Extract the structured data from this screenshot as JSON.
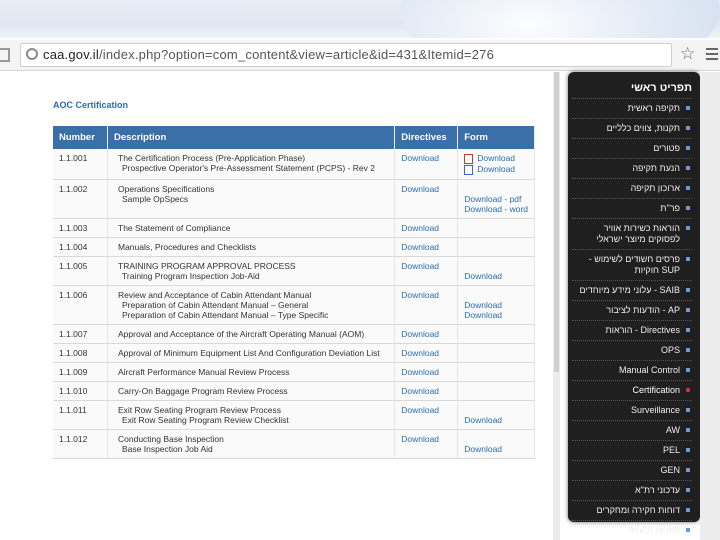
{
  "browser": {
    "url_domain": "caa.gov.il",
    "url_path": "/index.php?option=com_content&view=article&id=431&Itemid=276"
  },
  "page": {
    "title": "AOC Certification",
    "columns": [
      "Number",
      "Description",
      "Directives",
      "Form"
    ],
    "rows": [
      {
        "number": "1.1.001",
        "desc": "The Certification Process (Pre-Application Phase)",
        "sub": "Prospective Operator's Pre-Assessment Statement (PCPS) - Rev 2",
        "directive": "Download",
        "forms": [
          "Download",
          "Download"
        ],
        "form_icons": [
          "pdf-icon",
          "word-icon"
        ]
      },
      {
        "number": "1.1.002",
        "desc": "Operations Specifications",
        "sub": "Sample OpSpecs",
        "directive": "Download",
        "forms": [
          "Download - pdf",
          "Download - word"
        ]
      },
      {
        "number": "1.1.003",
        "desc": "The Statement of Compliance",
        "directive": "Download"
      },
      {
        "number": "1.1.004",
        "desc": "Manuals, Procedures and Checklists",
        "directive": "Download"
      },
      {
        "number": "1.1.005",
        "desc": "TRAINING PROGRAM APPROVAL PROCESS",
        "sub": "Training Program Inspection Job-Aid",
        "directive": "Download",
        "forms": [
          "Download"
        ]
      },
      {
        "number": "1.1.006",
        "desc": "Review and Acceptance of Cabin Attendant Manual",
        "sub": "Preparation of Cabin Attendant Manual – General",
        "sub2": "Preparation of Cabin Attendant Manual – Type Specific",
        "directive": "Download",
        "forms": [
          "Download",
          "Download"
        ]
      },
      {
        "number": "1.1.007",
        "desc": "Approval and Acceptance of the Aircraft Operating Manual (AOM)",
        "directive": "Download"
      },
      {
        "number": "1.1.008",
        "desc": "Approval of Minimum Equipment List And Configuration Deviation List",
        "directive": "Download"
      },
      {
        "number": "1.1.009",
        "desc": "Aircraft Performance Manual Review Process",
        "directive": "Download"
      },
      {
        "number": "1.1.010",
        "desc": "Carry-On Baggage Program Review Process",
        "directive": "Download"
      },
      {
        "number": "1.1.011",
        "desc": "Exit Row Seating Program Review Process",
        "sub": "Exit Row Seating Program Review Checklist",
        "directive": "Download",
        "forms": [
          "Download"
        ]
      },
      {
        "number": "1.1.012",
        "desc": "Conducting Base Inspection",
        "sub": "Base Inspection Job Aid",
        "directive": "Download",
        "forms": [
          "Download"
        ]
      }
    ]
  },
  "sidebar": {
    "header": "תפריט ראשי",
    "items": [
      {
        "label": "תקיפה ראשית"
      },
      {
        "label": "תקנות, צווים כלליים"
      },
      {
        "label": "פטורים"
      },
      {
        "label": "הנעת תקיפה"
      },
      {
        "label": "ארוכון תקיפה"
      },
      {
        "label": "פר\"ת"
      },
      {
        "label": "הוראות כשירות אוויר לפסוקים מיוצר ישראלי"
      },
      {
        "label": "פרסים חשודים לשימוש - SUP חוקיות"
      },
      {
        "label": "SAIB - עלוני מידע מיוחדים"
      },
      {
        "label": "AP - הודעות לציבור"
      },
      {
        "label": "Directives - הוראות"
      },
      {
        "label": "OPS"
      },
      {
        "label": "Manual Control"
      },
      {
        "label": "Certification",
        "active": true
      },
      {
        "label": "Surveillance"
      },
      {
        "label": "AW"
      },
      {
        "label": "PEL"
      },
      {
        "label": "GEN"
      },
      {
        "label": "עדכוני רת\"א"
      },
      {
        "label": "דוחות חקירה ומחקרים"
      },
      {
        "label": "חוזרות הנעוזה"
      }
    ]
  }
}
